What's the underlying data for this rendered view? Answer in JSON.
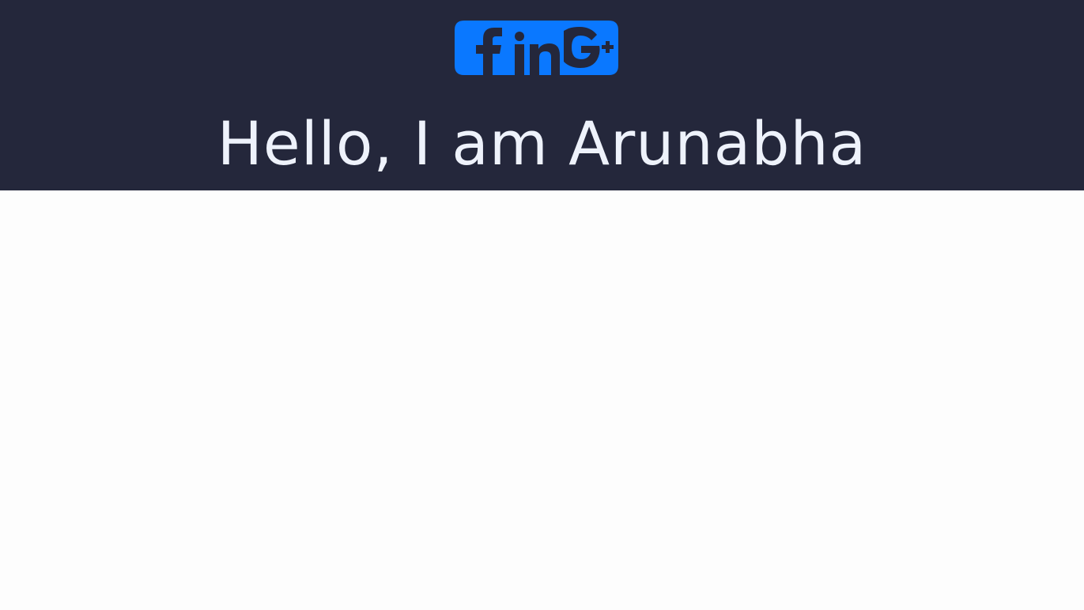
{
  "header": {
    "headline": "Hello, I am Arunabha",
    "background_color": "#24273b",
    "text_color": "#eef2fb"
  },
  "social": {
    "accent_color": "#0a78ff",
    "icons": [
      {
        "name": "facebook-icon"
      },
      {
        "name": "linkedin-icon"
      },
      {
        "name": "google-plus-icon"
      }
    ]
  }
}
